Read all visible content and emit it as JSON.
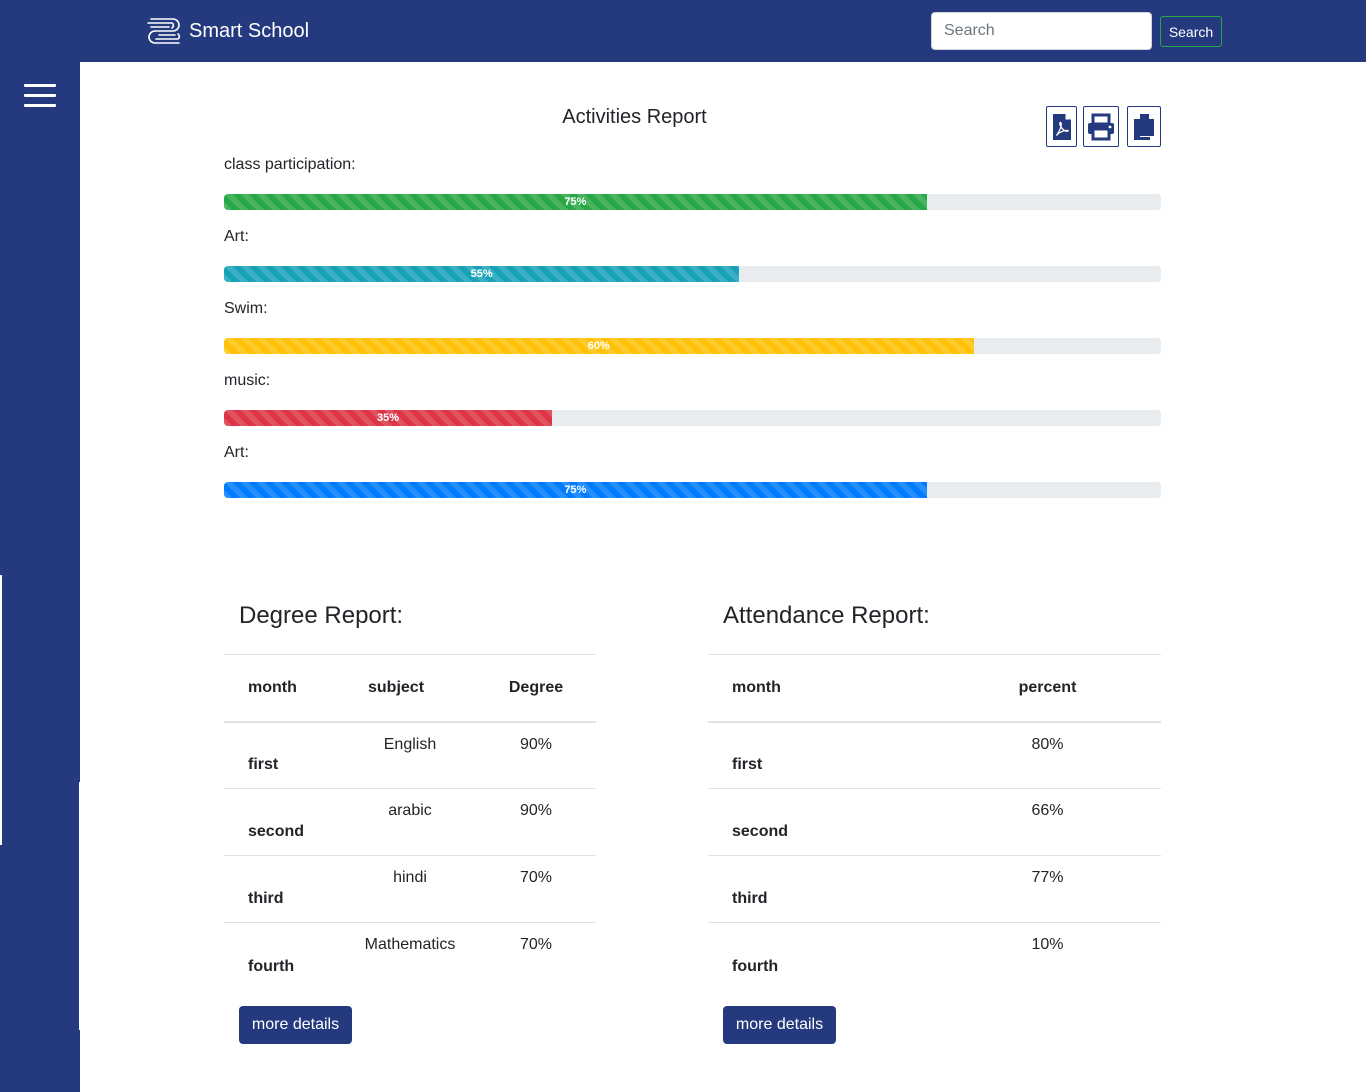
{
  "header": {
    "brand_name": "Smart School",
    "search_placeholder": "Search",
    "search_button": "Search"
  },
  "activities": {
    "title": "Activities Report",
    "bars": [
      {
        "label": "class participation:",
        "value_text": "75%",
        "color": "#28a745"
      },
      {
        "label": "Art:",
        "value_text": "55%",
        "color": "#17a2b8"
      },
      {
        "label": "Swim:",
        "value_text": "60%",
        "color": "#ffc107"
      },
      {
        "label": "music:",
        "value_text": "35%",
        "color": "#dc3545"
      },
      {
        "label": "Art:",
        "value_text": "75%",
        "color": "#007bff"
      }
    ],
    "fill_fractions": [
      0.75,
      0.55,
      0.8,
      0.35,
      0.75
    ],
    "tools": [
      "pdf-icon",
      "print-icon",
      "copy-icon"
    ]
  },
  "degree_report": {
    "title": "Degree Report:",
    "columns": [
      "month",
      "subject",
      "Degree"
    ],
    "rows": [
      [
        "first",
        "English",
        "90%"
      ],
      [
        "second",
        "arabic",
        "90%"
      ],
      [
        "third",
        "hindi",
        "70%"
      ],
      [
        "fourth",
        "Mathematics",
        "70%"
      ]
    ],
    "button": "more details"
  },
  "attendance_report": {
    "title": "Attendance Report:",
    "columns": [
      "month",
      "percent"
    ],
    "rows": [
      [
        "first",
        "80%"
      ],
      [
        "second",
        "66%"
      ],
      [
        "third",
        "77%"
      ],
      [
        "fourth",
        "10%"
      ]
    ],
    "button": "more details"
  },
  "colors": {
    "brand": "#253a7e",
    "track": "#e9ecef"
  }
}
